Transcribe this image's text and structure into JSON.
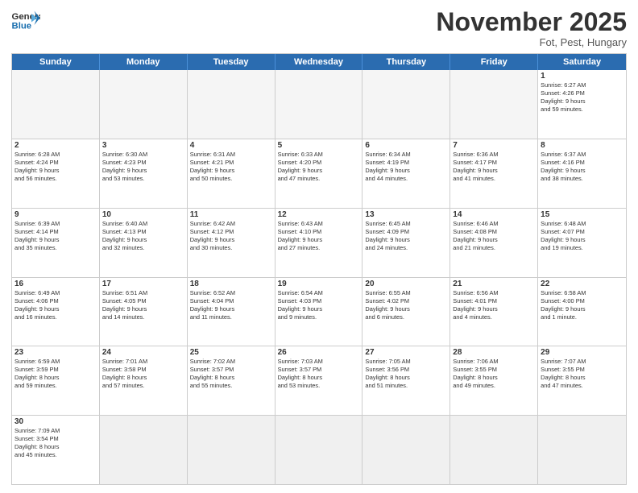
{
  "header": {
    "logo_general": "General",
    "logo_blue": "Blue",
    "month_title": "November 2025",
    "subtitle": "Fot, Pest, Hungary"
  },
  "days_of_week": [
    "Sunday",
    "Monday",
    "Tuesday",
    "Wednesday",
    "Thursday",
    "Friday",
    "Saturday"
  ],
  "weeks": [
    [
      {
        "day": "",
        "info": ""
      },
      {
        "day": "",
        "info": ""
      },
      {
        "day": "",
        "info": ""
      },
      {
        "day": "",
        "info": ""
      },
      {
        "day": "",
        "info": ""
      },
      {
        "day": "",
        "info": ""
      },
      {
        "day": "1",
        "info": "Sunrise: 6:27 AM\nSunset: 4:26 PM\nDaylight: 9 hours\nand 59 minutes."
      }
    ],
    [
      {
        "day": "2",
        "info": "Sunrise: 6:28 AM\nSunset: 4:24 PM\nDaylight: 9 hours\nand 56 minutes."
      },
      {
        "day": "3",
        "info": "Sunrise: 6:30 AM\nSunset: 4:23 PM\nDaylight: 9 hours\nand 53 minutes."
      },
      {
        "day": "4",
        "info": "Sunrise: 6:31 AM\nSunset: 4:21 PM\nDaylight: 9 hours\nand 50 minutes."
      },
      {
        "day": "5",
        "info": "Sunrise: 6:33 AM\nSunset: 4:20 PM\nDaylight: 9 hours\nand 47 minutes."
      },
      {
        "day": "6",
        "info": "Sunrise: 6:34 AM\nSunset: 4:19 PM\nDaylight: 9 hours\nand 44 minutes."
      },
      {
        "day": "7",
        "info": "Sunrise: 6:36 AM\nSunset: 4:17 PM\nDaylight: 9 hours\nand 41 minutes."
      },
      {
        "day": "8",
        "info": "Sunrise: 6:37 AM\nSunset: 4:16 PM\nDaylight: 9 hours\nand 38 minutes."
      }
    ],
    [
      {
        "day": "9",
        "info": "Sunrise: 6:39 AM\nSunset: 4:14 PM\nDaylight: 9 hours\nand 35 minutes."
      },
      {
        "day": "10",
        "info": "Sunrise: 6:40 AM\nSunset: 4:13 PM\nDaylight: 9 hours\nand 32 minutes."
      },
      {
        "day": "11",
        "info": "Sunrise: 6:42 AM\nSunset: 4:12 PM\nDaylight: 9 hours\nand 30 minutes."
      },
      {
        "day": "12",
        "info": "Sunrise: 6:43 AM\nSunset: 4:10 PM\nDaylight: 9 hours\nand 27 minutes."
      },
      {
        "day": "13",
        "info": "Sunrise: 6:45 AM\nSunset: 4:09 PM\nDaylight: 9 hours\nand 24 minutes."
      },
      {
        "day": "14",
        "info": "Sunrise: 6:46 AM\nSunset: 4:08 PM\nDaylight: 9 hours\nand 21 minutes."
      },
      {
        "day": "15",
        "info": "Sunrise: 6:48 AM\nSunset: 4:07 PM\nDaylight: 9 hours\nand 19 minutes."
      }
    ],
    [
      {
        "day": "16",
        "info": "Sunrise: 6:49 AM\nSunset: 4:06 PM\nDaylight: 9 hours\nand 16 minutes."
      },
      {
        "day": "17",
        "info": "Sunrise: 6:51 AM\nSunset: 4:05 PM\nDaylight: 9 hours\nand 14 minutes."
      },
      {
        "day": "18",
        "info": "Sunrise: 6:52 AM\nSunset: 4:04 PM\nDaylight: 9 hours\nand 11 minutes."
      },
      {
        "day": "19",
        "info": "Sunrise: 6:54 AM\nSunset: 4:03 PM\nDaylight: 9 hours\nand 9 minutes."
      },
      {
        "day": "20",
        "info": "Sunrise: 6:55 AM\nSunset: 4:02 PM\nDaylight: 9 hours\nand 6 minutes."
      },
      {
        "day": "21",
        "info": "Sunrise: 6:56 AM\nSunset: 4:01 PM\nDaylight: 9 hours\nand 4 minutes."
      },
      {
        "day": "22",
        "info": "Sunrise: 6:58 AM\nSunset: 4:00 PM\nDaylight: 9 hours\nand 1 minute."
      }
    ],
    [
      {
        "day": "23",
        "info": "Sunrise: 6:59 AM\nSunset: 3:59 PM\nDaylight: 8 hours\nand 59 minutes."
      },
      {
        "day": "24",
        "info": "Sunrise: 7:01 AM\nSunset: 3:58 PM\nDaylight: 8 hours\nand 57 minutes."
      },
      {
        "day": "25",
        "info": "Sunrise: 7:02 AM\nSunset: 3:57 PM\nDaylight: 8 hours\nand 55 minutes."
      },
      {
        "day": "26",
        "info": "Sunrise: 7:03 AM\nSunset: 3:57 PM\nDaylight: 8 hours\nand 53 minutes."
      },
      {
        "day": "27",
        "info": "Sunrise: 7:05 AM\nSunset: 3:56 PM\nDaylight: 8 hours\nand 51 minutes."
      },
      {
        "day": "28",
        "info": "Sunrise: 7:06 AM\nSunset: 3:55 PM\nDaylight: 8 hours\nand 49 minutes."
      },
      {
        "day": "29",
        "info": "Sunrise: 7:07 AM\nSunset: 3:55 PM\nDaylight: 8 hours\nand 47 minutes."
      }
    ],
    [
      {
        "day": "30",
        "info": "Sunrise: 7:09 AM\nSunset: 3:54 PM\nDaylight: 8 hours\nand 45 minutes."
      },
      {
        "day": "",
        "info": ""
      },
      {
        "day": "",
        "info": ""
      },
      {
        "day": "",
        "info": ""
      },
      {
        "day": "",
        "info": ""
      },
      {
        "day": "",
        "info": ""
      },
      {
        "day": "",
        "info": ""
      }
    ]
  ]
}
